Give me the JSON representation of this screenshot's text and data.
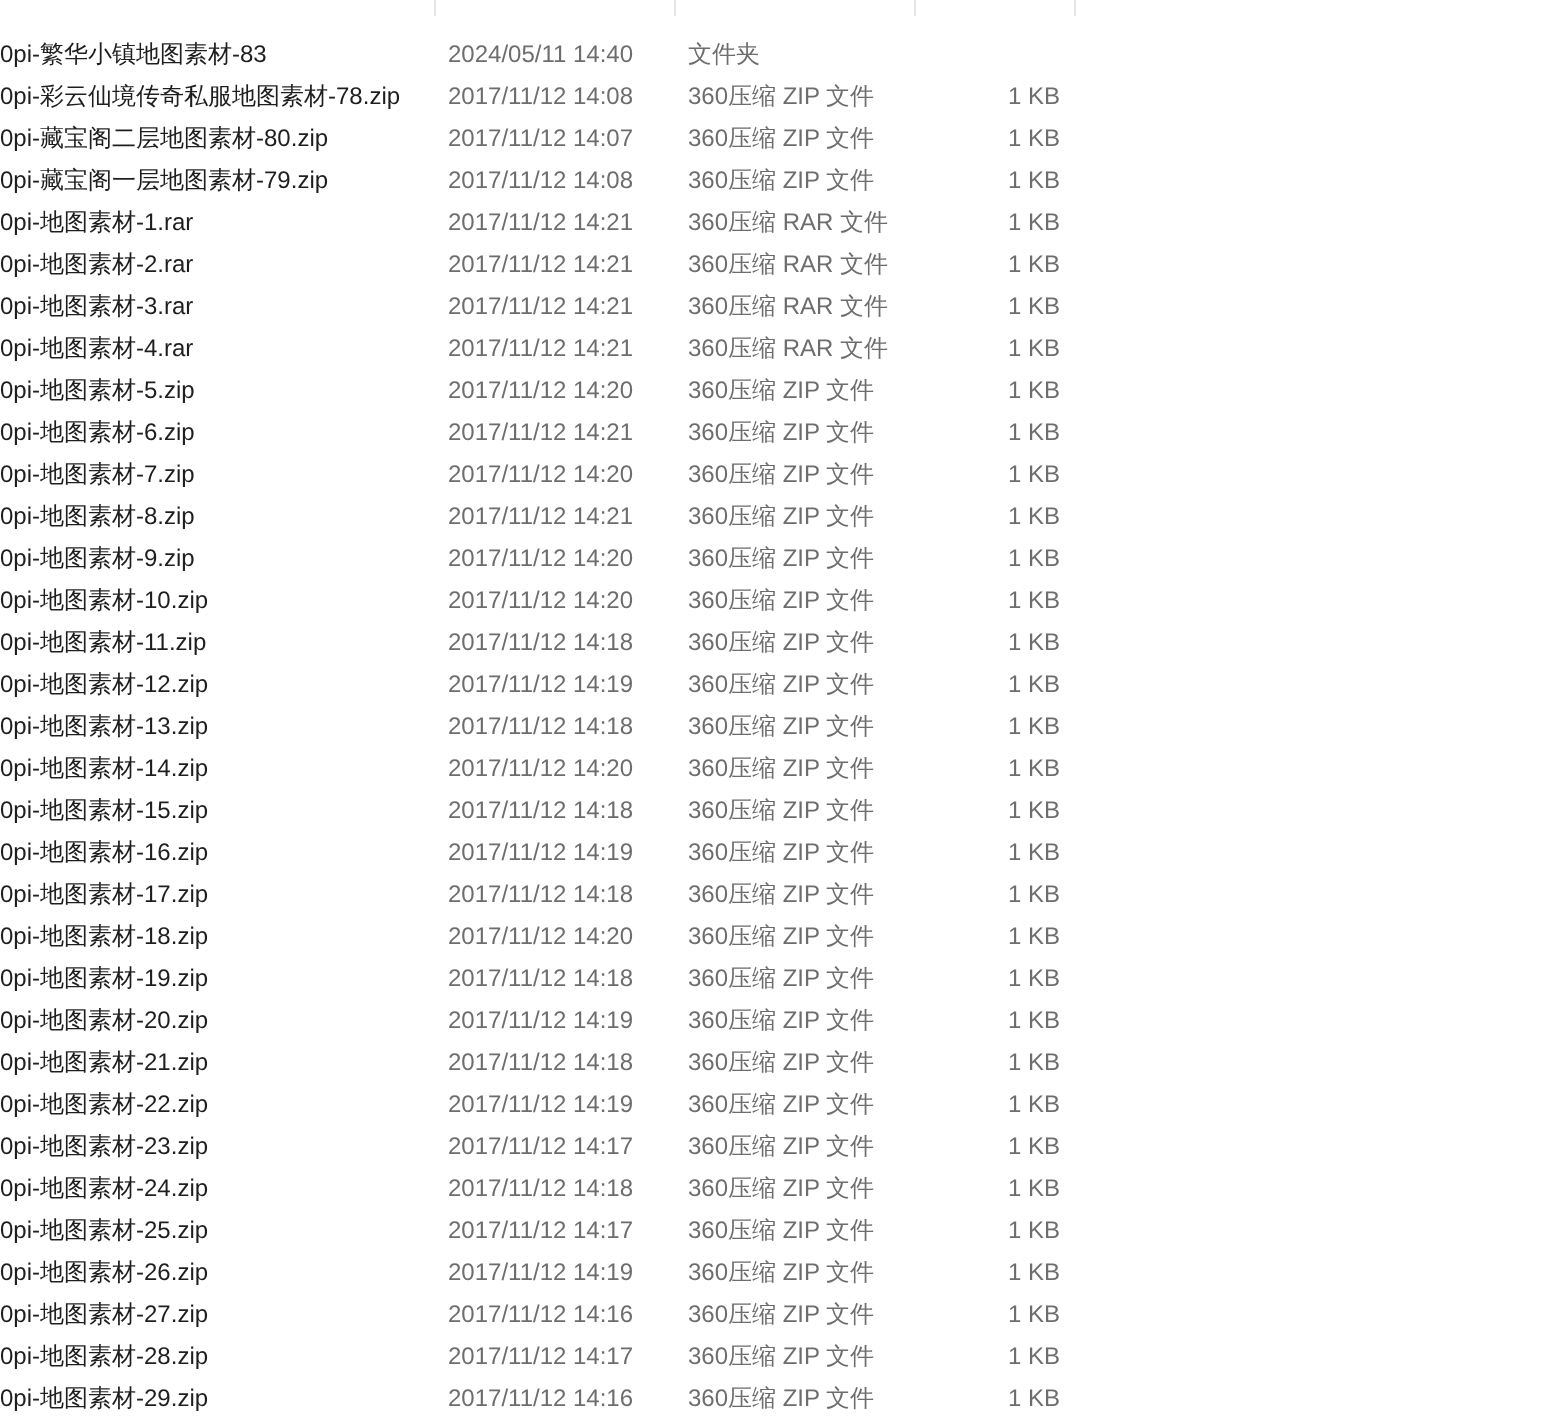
{
  "files": [
    {
      "name": "0pi-繁华小镇地图素材-83",
      "modified": "2024/05/11 14:40",
      "type": "文件夹"
    },
    {
      "name": "0pi-彩云仙境传奇私服地图素材-78.zip",
      "modified": "2017/11/12 14:08",
      "type": "360压缩 ZIP 文件",
      "size": "1 KB"
    },
    {
      "name": "0pi-藏宝阁二层地图素材-80.zip",
      "modified": "2017/11/12 14:07",
      "type": "360压缩 ZIP 文件",
      "size": "1 KB"
    },
    {
      "name": "0pi-藏宝阁一层地图素材-79.zip",
      "modified": "2017/11/12 14:08",
      "type": "360压缩 ZIP 文件",
      "size": "1 KB"
    },
    {
      "name": "0pi-地图素材-1.rar",
      "modified": "2017/11/12 14:21",
      "type": "360压缩 RAR 文件",
      "size": "1 KB"
    },
    {
      "name": "0pi-地图素材-2.rar",
      "modified": "2017/11/12 14:21",
      "type": "360压缩 RAR 文件",
      "size": "1 KB"
    },
    {
      "name": "0pi-地图素材-3.rar",
      "modified": "2017/11/12 14:21",
      "type": "360压缩 RAR 文件",
      "size": "1 KB"
    },
    {
      "name": "0pi-地图素材-4.rar",
      "modified": "2017/11/12 14:21",
      "type": "360压缩 RAR 文件",
      "size": "1 KB"
    },
    {
      "name": "0pi-地图素材-5.zip",
      "modified": "2017/11/12 14:20",
      "type": "360压缩 ZIP 文件",
      "size": "1 KB"
    },
    {
      "name": "0pi-地图素材-6.zip",
      "modified": "2017/11/12 14:21",
      "type": "360压缩 ZIP 文件",
      "size": "1 KB"
    },
    {
      "name": "0pi-地图素材-7.zip",
      "modified": "2017/11/12 14:20",
      "type": "360压缩 ZIP 文件",
      "size": "1 KB"
    },
    {
      "name": "0pi-地图素材-8.zip",
      "modified": "2017/11/12 14:21",
      "type": "360压缩 ZIP 文件",
      "size": "1 KB"
    },
    {
      "name": "0pi-地图素材-9.zip",
      "modified": "2017/11/12 14:20",
      "type": "360压缩 ZIP 文件",
      "size": "1 KB"
    },
    {
      "name": "0pi-地图素材-10.zip",
      "modified": "2017/11/12 14:20",
      "type": "360压缩 ZIP 文件",
      "size": "1 KB"
    },
    {
      "name": "0pi-地图素材-11.zip",
      "modified": "2017/11/12 14:18",
      "type": "360压缩 ZIP 文件",
      "size": "1 KB"
    },
    {
      "name": "0pi-地图素材-12.zip",
      "modified": "2017/11/12 14:19",
      "type": "360压缩 ZIP 文件",
      "size": "1 KB"
    },
    {
      "name": "0pi-地图素材-13.zip",
      "modified": "2017/11/12 14:18",
      "type": "360压缩 ZIP 文件",
      "size": "1 KB"
    },
    {
      "name": "0pi-地图素材-14.zip",
      "modified": "2017/11/12 14:20",
      "type": "360压缩 ZIP 文件",
      "size": "1 KB"
    },
    {
      "name": "0pi-地图素材-15.zip",
      "modified": "2017/11/12 14:18",
      "type": "360压缩 ZIP 文件",
      "size": "1 KB"
    },
    {
      "name": "0pi-地图素材-16.zip",
      "modified": "2017/11/12 14:19",
      "type": "360压缩 ZIP 文件",
      "size": "1 KB"
    },
    {
      "name": "0pi-地图素材-17.zip",
      "modified": "2017/11/12 14:18",
      "type": "360压缩 ZIP 文件",
      "size": "1 KB"
    },
    {
      "name": "0pi-地图素材-18.zip",
      "modified": "2017/11/12 14:20",
      "type": "360压缩 ZIP 文件",
      "size": "1 KB"
    },
    {
      "name": "0pi-地图素材-19.zip",
      "modified": "2017/11/12 14:18",
      "type": "360压缩 ZIP 文件",
      "size": "1 KB"
    },
    {
      "name": "0pi-地图素材-20.zip",
      "modified": "2017/11/12 14:19",
      "type": "360压缩 ZIP 文件",
      "size": "1 KB"
    },
    {
      "name": "0pi-地图素材-21.zip",
      "modified": "2017/11/12 14:18",
      "type": "360压缩 ZIP 文件",
      "size": "1 KB"
    },
    {
      "name": "0pi-地图素材-22.zip",
      "modified": "2017/11/12 14:19",
      "type": "360压缩 ZIP 文件",
      "size": "1 KB"
    },
    {
      "name": "0pi-地图素材-23.zip",
      "modified": "2017/11/12 14:17",
      "type": "360压缩 ZIP 文件",
      "size": "1 KB"
    },
    {
      "name": "0pi-地图素材-24.zip",
      "modified": "2017/11/12 14:18",
      "type": "360压缩 ZIP 文件",
      "size": "1 KB"
    },
    {
      "name": "0pi-地图素材-25.zip",
      "modified": "2017/11/12 14:17",
      "type": "360压缩 ZIP 文件",
      "size": "1 KB"
    },
    {
      "name": "0pi-地图素材-26.zip",
      "modified": "2017/11/12 14:19",
      "type": "360压缩 ZIP 文件",
      "size": "1 KB"
    },
    {
      "name": "0pi-地图素材-27.zip",
      "modified": "2017/11/12 14:16",
      "type": "360压缩 ZIP 文件",
      "size": "1 KB"
    },
    {
      "name": "0pi-地图素材-28.zip",
      "modified": "2017/11/12 14:17",
      "type": "360压缩 ZIP 文件",
      "size": "1 KB"
    },
    {
      "name": "0pi-地图素材-29.zip",
      "modified": "2017/11/12 14:16",
      "type": "360压缩 ZIP 文件",
      "size": "1 KB"
    }
  ]
}
